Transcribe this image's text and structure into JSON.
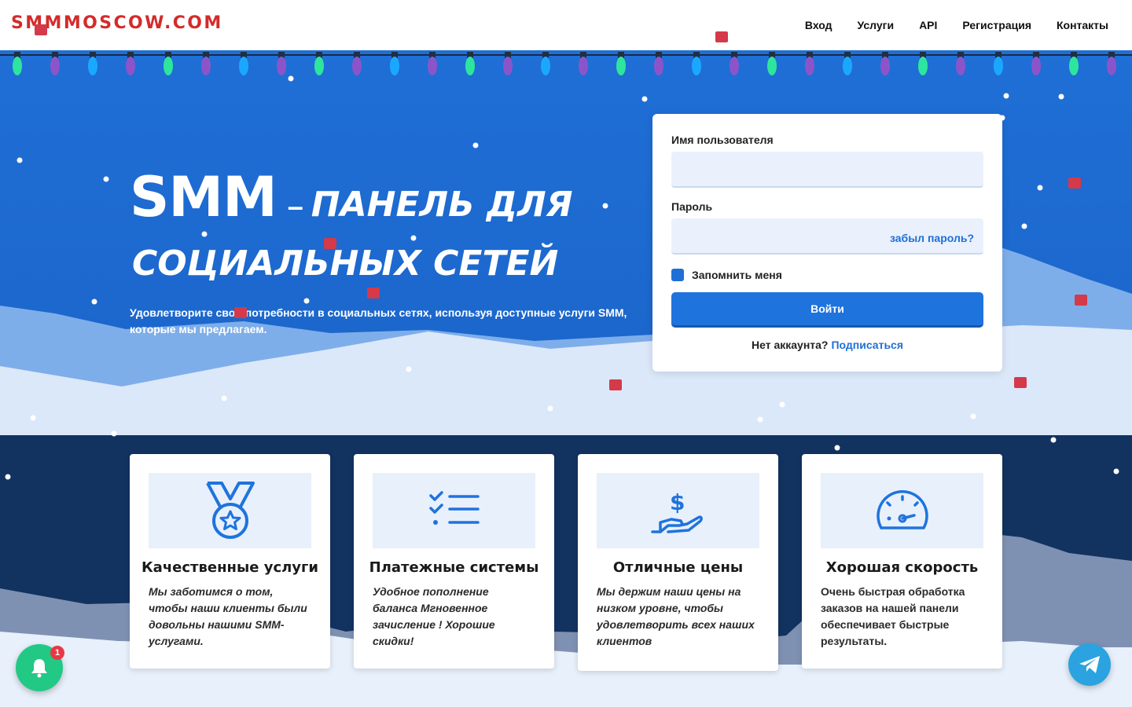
{
  "header": {
    "logo": "SMMMOSCOW.COM",
    "nav": [
      "Вход",
      "Услуги",
      "API",
      "Регистрация",
      "Контакты"
    ]
  },
  "hero": {
    "title_smm": "SMM",
    "title_dash": "–",
    "title_rest": "ПАНЕЛЬ ДЛЯ",
    "title_line2": "СОЦИАЛЬНЫХ СЕТЕЙ",
    "subtitle": "Удовлетворите свои потребности в социальных сетях, используя доступные услуги SMM, которые мы предлагаем."
  },
  "login": {
    "username_label": "Имя пользователя",
    "password_label": "Пароль",
    "forgot": "забыл пароль?",
    "remember": "Запомнить меня",
    "submit": "Войти",
    "no_account": "Нет аккаунта?",
    "signup": "Подписаться"
  },
  "cards": [
    {
      "icon": "medal-icon",
      "title": "Качественные услуги",
      "text": "Мы заботимся о том, чтобы наши клиенты были довольны нашими SMM-услугами."
    },
    {
      "icon": "checklist-icon",
      "title": "Платежные системы",
      "text": "Удобное пополнение баланса Мгновенное зачисление ! Хорошие скидки!"
    },
    {
      "icon": "price-hand-icon",
      "title": "Отличные цены",
      "text": "Мы держим наши цены на низком уровне, чтобы удовлетворить всех наших клиентов"
    },
    {
      "icon": "speedometer-icon",
      "title": "Хорошая скорость",
      "text": "Очень быстрая обработка заказов на нашей панели обеспечивает быстрые результаты."
    }
  ],
  "notifications": {
    "badge": "1"
  },
  "colors": {
    "primary": "#1f6fd6",
    "logo": "#d42b2b",
    "dark": "#123260",
    "bell": "#21c985",
    "telegram": "#2aa3e0"
  }
}
